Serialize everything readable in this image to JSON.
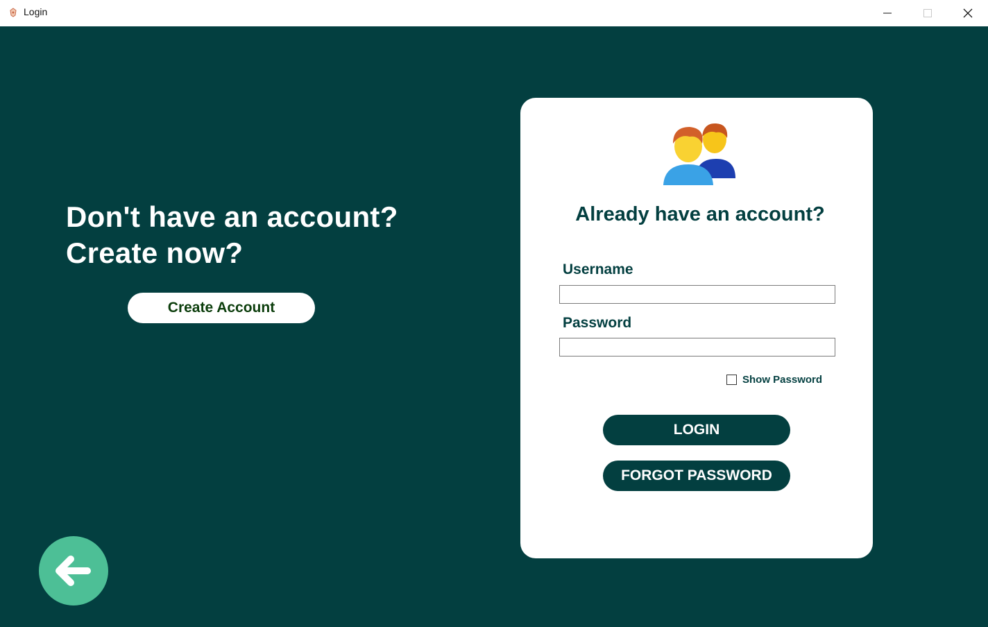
{
  "window": {
    "title": "Login",
    "icons": {
      "app": "app-logo-icon",
      "minimize": "minimize-icon",
      "maximize": "maximize-icon",
      "close": "close-icon"
    }
  },
  "left_panel": {
    "heading_line1": "Don't have an account?",
    "heading_line2": "Create now?",
    "create_button": "Create Account",
    "back_icon": "arrow-left-icon"
  },
  "login_card": {
    "icon": "users-icon",
    "title": "Already have an account?",
    "username_label": "Username",
    "username_value": "",
    "password_label": "Password",
    "password_value": "",
    "show_password_label": "Show Password",
    "show_password_checked": false,
    "login_button": "LOGIN",
    "forgot_button": "FORGOT PASSWORD"
  },
  "colors": {
    "background": "#033f40",
    "card": "#ffffff",
    "primary_text": "#033f40",
    "back_button": "#4dbf96"
  }
}
